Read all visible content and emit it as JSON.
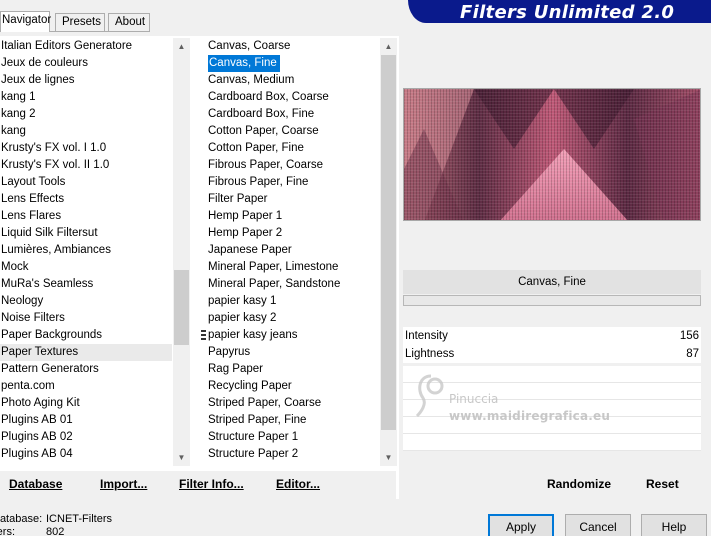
{
  "tabs": [
    {
      "label": "Navigator"
    },
    {
      "label": "Presets"
    },
    {
      "label": "About"
    }
  ],
  "header": {
    "title": "Filters Unlimited 2.0"
  },
  "categories": [
    "Italian Editors Generatore",
    "Jeux de couleurs",
    "Jeux de lignes",
    "kang 1",
    "kang 2",
    "kang",
    "Krusty's FX vol. I 1.0",
    "Krusty's FX vol. II 1.0",
    "Layout Tools",
    "Lens Effects",
    "Lens Flares",
    "Liquid Silk Filtersut",
    "Lumières, Ambiances",
    "Mock",
    "MuRa's Seamless",
    "Neology",
    "Noise Filters",
    "Paper Backgrounds",
    "Paper Textures",
    "Pattern Generators",
    "penta.com",
    "Photo Aging Kit",
    "Plugins AB 01",
    "Plugins AB 02",
    "Plugins AB 04"
  ],
  "selected_category": "Paper Textures",
  "filters": [
    "Canvas, Coarse",
    "Canvas, Fine",
    "Canvas, Medium",
    "Cardboard Box, Coarse",
    "Cardboard Box, Fine",
    "Cotton Paper, Coarse",
    "Cotton Paper, Fine",
    "Fibrous Paper, Coarse",
    "Fibrous Paper, Fine",
    "Filter Paper",
    "Hemp Paper 1",
    "Hemp Paper 2",
    "Japanese Paper",
    "Mineral Paper, Limestone",
    "Mineral Paper, Sandstone",
    "papier kasy 1",
    "papier kasy 2",
    "papier kasy jeans",
    "Papyrus",
    "Rag Paper",
    "Recycling Paper",
    "Striped Paper, Coarse",
    "Striped Paper, Fine",
    "Structure Paper 1",
    "Structure Paper 2"
  ],
  "selected_filter": "Canvas, Fine",
  "preview": {
    "filter_name": "Canvas, Fine"
  },
  "params": [
    {
      "name": "Intensity",
      "value": "156"
    },
    {
      "name": "Lightness",
      "value": "87"
    }
  ],
  "watermark": {
    "name": "Pinuccia",
    "url": "www.maidiregrafica.eu"
  },
  "left_buttons": {
    "database": "Database",
    "import": "Import...",
    "filter_info": "Filter Info...",
    "editor": "Editor..."
  },
  "right_buttons": {
    "randomize": "Randomize",
    "reset": "Reset"
  },
  "status": {
    "database_label": "Database:",
    "database_value": "ICNET-Filters",
    "filters_label": "Filters:",
    "filters_value": "802"
  },
  "dialog_buttons": {
    "apply": "Apply",
    "cancel": "Cancel",
    "help": "Help"
  },
  "colors": {
    "banner": "#0a1a8c",
    "selection": "#0078d7"
  }
}
